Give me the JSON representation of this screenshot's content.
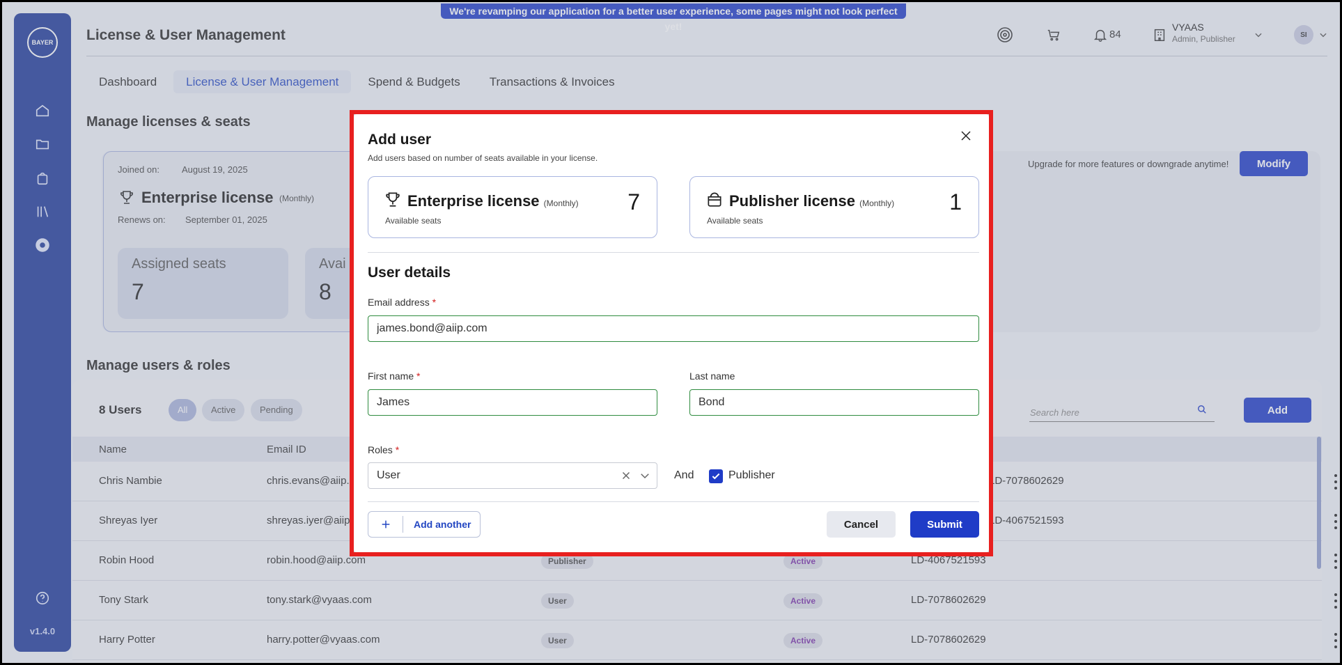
{
  "banner": "We're revamping our application for a better user experience, some pages might not look perfect yet!",
  "sidebar": {
    "logo_text": "BAYER",
    "version": "v1.4.0",
    "items": [
      "home-icon",
      "folder-icon",
      "bag-icon",
      "library-icon",
      "gear-icon"
    ],
    "help_icon": "help-icon"
  },
  "header": {
    "title": "License & User Management",
    "notifications": "84",
    "org_name": "VYAAS",
    "org_role": "Admin, Publisher",
    "avatar": "SI"
  },
  "tabs": [
    {
      "label": "Dashboard",
      "active": false
    },
    {
      "label": "License & User Management",
      "active": true
    },
    {
      "label": "Spend & Budgets",
      "active": false
    },
    {
      "label": "Transactions & Invoices",
      "active": false
    }
  ],
  "licenses": {
    "section_title": "Manage licenses & seats",
    "joined_label": "Joined on:",
    "joined_date": "August 19, 2025",
    "license_name": "Enterprise license",
    "license_period": "(Monthly)",
    "renews_label": "Renews on:",
    "renews_date": "September 01, 2025",
    "assigned_label": "Assigned seats",
    "assigned_value": "7",
    "available_label": "Avai",
    "available_value": "8",
    "upgrade_text": "Upgrade for more features or downgrade anytime!",
    "modify_label": "Modify"
  },
  "users": {
    "section_title": "Manage users & roles",
    "count": "8 Users",
    "filters": [
      {
        "label": "All",
        "active": true
      },
      {
        "label": "Active",
        "active": false
      },
      {
        "label": "Pending",
        "active": false
      }
    ],
    "search_placeholder": "Search here",
    "add_label": "Add",
    "columns": [
      "Name",
      "Email ID"
    ],
    "rows": [
      {
        "name": "Chris Nambie",
        "email": "chris.evans@aiip.",
        "role": "",
        "status": "",
        "id": "LD-7078602629"
      },
      {
        "name": "Shreyas Iyer",
        "email": "shreyas.iyer@aiip",
        "role": "",
        "status": "",
        "id": "LD-4067521593"
      },
      {
        "name": "Robin Hood",
        "email": "robin.hood@aiip.com",
        "role": "Publisher",
        "status": "Active",
        "id": "LD-4067521593"
      },
      {
        "name": "Tony Stark",
        "email": "tony.stark@vyaas.com",
        "role": "User",
        "status": "Active",
        "id": "LD-7078602629"
      },
      {
        "name": "Harry Potter",
        "email": "harry.potter@vyaas.com",
        "role": "User",
        "status": "Active",
        "id": "LD-7078602629"
      }
    ]
  },
  "modal": {
    "title": "Add user",
    "subtitle": "Add users based on number of seats available in your license.",
    "enterprise": {
      "name": "Enterprise license",
      "period": "(Monthly)",
      "seats_label": "Available seats",
      "count": "7"
    },
    "publisher": {
      "name": "Publisher license",
      "period": "(Monthly)",
      "seats_label": "Available seats",
      "count": "1"
    },
    "section_title": "User details",
    "email_label": "Email address",
    "email_value": "james.bond@aiip.com",
    "first_name_label": "First name",
    "first_name_value": "James",
    "last_name_label": "Last name",
    "last_name_value": "Bond",
    "roles_label": "Roles",
    "role_value": "User",
    "and_text": "And",
    "publisher_label": "Publisher",
    "publisher_checked": true,
    "required_mark": "*",
    "add_another_label": "Add another",
    "cancel_label": "Cancel",
    "submit_label": "Submit"
  },
  "colors": {
    "primary": "#1f3cc7",
    "sidebar": "#1f3a9a",
    "highlight_border": "#e8201f",
    "valid_border": "#2e8b3e"
  }
}
